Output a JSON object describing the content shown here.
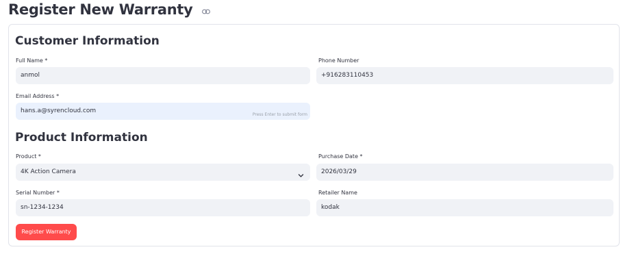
{
  "page": {
    "title": "Register New Warranty"
  },
  "customer": {
    "heading": "Customer Information",
    "full_name_label": "Full Name *",
    "full_name_value": "anmol",
    "phone_label": "Phone Number",
    "phone_value": "+916283110453",
    "email_label": "Email Address *",
    "email_value": "hans.a@syrencloud.com",
    "email_hint": "Press Enter to submit form"
  },
  "product": {
    "heading": "Product Information",
    "product_label": "Product *",
    "product_value": "4K Action Camera",
    "purchase_date_label": "Purchase Date *",
    "purchase_date_value": "2026/03/29",
    "serial_label": "Serial Number *",
    "serial_value": "sn-1234-1234",
    "retailer_label": "Retailer Name",
    "retailer_value": "kodak"
  },
  "actions": {
    "submit_label": "Register Warranty"
  },
  "colors": {
    "accent": "#ff4b4b",
    "field_bg": "#f0f2f6",
    "focused_field_bg": "#eaf1fd",
    "text": "#31333f"
  },
  "icons": {
    "title_icon": "link-icon",
    "select_icon": "chevron-down-icon"
  }
}
